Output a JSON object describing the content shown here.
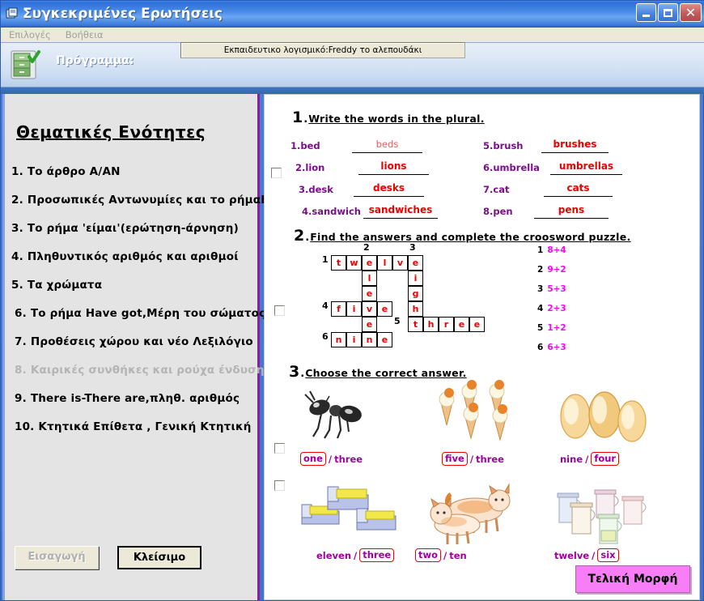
{
  "window": {
    "title": "Συγκεκριμένες Ερωτήσεις",
    "icon": "window-document-icon",
    "minimize_label": "_",
    "maximize_label": "□",
    "close_label": "✕"
  },
  "menu": {
    "items": [
      {
        "label": "Επιλογές"
      },
      {
        "label": "Βοήθεια"
      }
    ]
  },
  "toolbar": {
    "icon": "filing-cabinet-check-icon",
    "program_label": "Πρόγραμμα:",
    "program_value": "Εκπαιδευτικο λογισμικό:Freddy το αλεπουδάκι"
  },
  "sidebar": {
    "title": "Θεματικές Ενότητες",
    "items": [
      {
        "num": "1.",
        "label": "Το άρθρο A/AN",
        "disabled": false
      },
      {
        "num": "2.",
        "label": "Προσωπικές Αντωνυμίες και το ρήμαBe",
        "disabled": false
      },
      {
        "num": "3.",
        "label": "Το ρήμα 'είμαι'(ερώτηση-άρνηση)",
        "disabled": false
      },
      {
        "num": "4.",
        "label": "Πληθυντικός αριθμός και αριθμοί",
        "disabled": false
      },
      {
        "num": "5.",
        "label": "Τα χρώματα",
        "disabled": false
      },
      {
        "num": "6.",
        "label": "Το ρήμα Have got,Μέρη του σώματος",
        "disabled": false
      },
      {
        "num": "7.",
        "label": "Προθέσεις χώρου και νέο Λεξιλόγιο",
        "disabled": false
      },
      {
        "num": "8.",
        "label": "Καιρικές συνθήκες και ρούχα ένδυσης",
        "disabled": true
      },
      {
        "num": "9.",
        "label": "There is-There are,πληθ. αριθμός",
        "disabled": false
      },
      {
        "num": "10.",
        "label": "Κτητικά Επίθετα , Γενική Κτητική",
        "disabled": false
      }
    ],
    "buttons": {
      "insert": "Εισαγωγή",
      "close": "Κλείσιμο"
    }
  },
  "exercises": [
    {
      "number": "1",
      "title": "Write the words in the plural.",
      "left_items": [
        {
          "num": "1.",
          "word": "bed",
          "answer": "beds",
          "light": true
        },
        {
          "num": "2.",
          "word": "lion",
          "answer": "lions",
          "light": false
        },
        {
          "num": "3.",
          "word": "desk",
          "answer": "desks",
          "light": false
        },
        {
          "num": "4.",
          "word": "sandwich",
          "answer": "sandwiches",
          "light": false
        }
      ],
      "right_items": [
        {
          "num": "5.",
          "word": "brush",
          "answer": "brushes",
          "light": false
        },
        {
          "num": "6.",
          "word": "umbrella",
          "answer": "umbrellas",
          "light": false
        },
        {
          "num": "7.",
          "word": "cat",
          "answer": "cats",
          "light": false
        },
        {
          "num": "8.",
          "word": "pen",
          "answer": "pens",
          "light": false
        }
      ]
    },
    {
      "number": "2",
      "title": "Find the answers and complete the croosword puzzle.",
      "grid_numbers": [
        {
          "n": "1",
          "col": -1,
          "row": 0
        },
        {
          "n": "2",
          "col": 2,
          "row": -1
        },
        {
          "n": "3",
          "col": 5,
          "row": -1
        },
        {
          "n": "4",
          "col": -1,
          "row": 3
        },
        {
          "n": "5",
          "col": 4,
          "row": 4
        },
        {
          "n": "6",
          "col": -1,
          "row": 5
        }
      ],
      "cells": [
        {
          "c": 0,
          "r": 0,
          "ch": "t"
        },
        {
          "c": 1,
          "r": 0,
          "ch": "w"
        },
        {
          "c": 2,
          "r": 0,
          "ch": "e"
        },
        {
          "c": 3,
          "r": 0,
          "ch": "l"
        },
        {
          "c": 4,
          "r": 0,
          "ch": "v"
        },
        {
          "c": 5,
          "r": 0,
          "ch": "e"
        },
        {
          "c": 2,
          "r": 1,
          "ch": "l"
        },
        {
          "c": 5,
          "r": 1,
          "ch": "i"
        },
        {
          "c": 2,
          "r": 2,
          "ch": "e"
        },
        {
          "c": 5,
          "r": 2,
          "ch": "g"
        },
        {
          "c": 0,
          "r": 3,
          "ch": "f"
        },
        {
          "c": 1,
          "r": 3,
          "ch": "i"
        },
        {
          "c": 2,
          "r": 3,
          "ch": "v"
        },
        {
          "c": 3,
          "r": 3,
          "ch": "e"
        },
        {
          "c": 5,
          "r": 3,
          "ch": "h"
        },
        {
          "c": 2,
          "r": 4,
          "ch": "e"
        },
        {
          "c": 5,
          "r": 4,
          "ch": "t"
        },
        {
          "c": 6,
          "r": 4,
          "ch": "h"
        },
        {
          "c": 7,
          "r": 4,
          "ch": "r"
        },
        {
          "c": 8,
          "r": 4,
          "ch": "e"
        },
        {
          "c": 9,
          "r": 4,
          "ch": "e"
        },
        {
          "c": 0,
          "r": 5,
          "ch": "n"
        },
        {
          "c": 1,
          "r": 5,
          "ch": "i"
        },
        {
          "c": 2,
          "r": 5,
          "ch": "n"
        },
        {
          "c": 3,
          "r": 5,
          "ch": "e"
        }
      ],
      "clues": [
        {
          "n": "1",
          "v": "8+4"
        },
        {
          "n": "2",
          "v": "9+2"
        },
        {
          "n": "3",
          "v": "5+3"
        },
        {
          "n": "4",
          "v": "2+3"
        },
        {
          "n": "5",
          "v": "1+2"
        },
        {
          "n": "6",
          "v": "6+3"
        }
      ]
    },
    {
      "number": "3",
      "title": "Choose the correct answer.",
      "items": [
        {
          "picture": "ant-picture",
          "option_a": "one",
          "option_b": "three",
          "selected": "a"
        },
        {
          "picture": "ice-cream-cones-picture",
          "option_a": "five",
          "option_b": "three",
          "selected": "a"
        },
        {
          "picture": "eggs-picture",
          "option_a": "nine",
          "option_b": "four",
          "selected": "b"
        },
        {
          "picture": "beds-picture",
          "option_a": "eleven",
          "option_b": "three",
          "selected": "b"
        },
        {
          "picture": "cats-picture",
          "option_a": "two",
          "option_b": "ten",
          "selected": "a"
        },
        {
          "picture": "jugs-picture",
          "option_a": "twelve",
          "option_b": "six",
          "selected": "b"
        }
      ]
    }
  ],
  "final_button": {
    "label": "Τελική Μορφή"
  },
  "colors": {
    "answer_red": "#ee0000",
    "word_purple": "#7a0f8a",
    "clue_magenta": "#ff00ff",
    "option_purple": "#a000a0",
    "final_pink": "#f87ef8",
    "sidebar_accent": "#8a1f9a"
  }
}
